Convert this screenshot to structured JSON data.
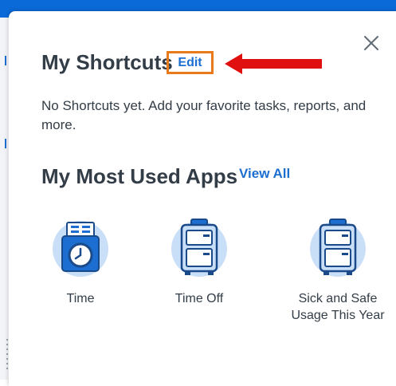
{
  "shortcuts": {
    "title": "My Shortcuts",
    "edit_label": "Edit",
    "empty_message": "No Shortcuts yet. Add your favorite tasks, reports, and more."
  },
  "apps": {
    "title": "My Most Used Apps",
    "view_all_label": "View All",
    "items": [
      {
        "label": "Time",
        "icon": "time-clock-icon"
      },
      {
        "label": "Time Off",
        "icon": "suitcase-icon"
      },
      {
        "label": "Sick and Safe Usage This Year",
        "icon": "suitcase-icon"
      }
    ]
  },
  "colors": {
    "accent": "#1c6fd1",
    "icon_bg": "#c9def7",
    "text": "#333d47",
    "highlight_box": "#e87a1c",
    "arrow": "#e01010",
    "top_bar": "#0a6ad8"
  }
}
